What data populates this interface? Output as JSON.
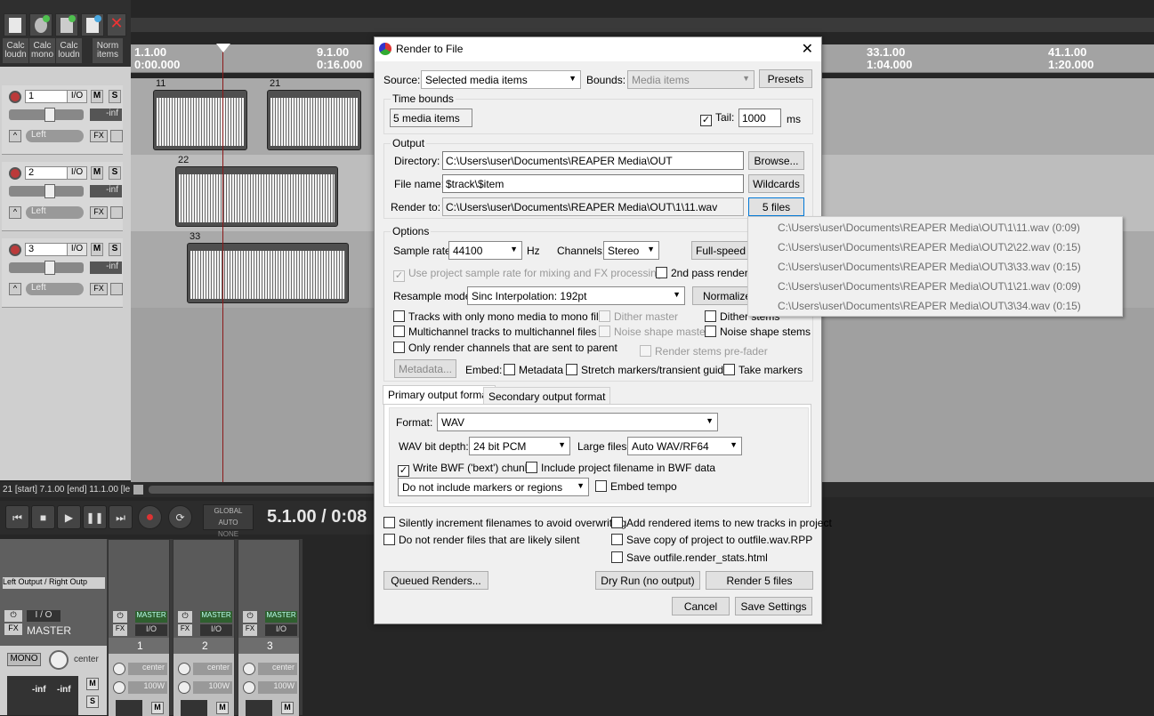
{
  "toolbar": {
    "action_buttons": [
      "Calc loudn",
      "Calc mono",
      "Calc loudn",
      "Norm items"
    ]
  },
  "ruler": {
    "marks": [
      {
        "bar": "1.1.00",
        "time": "0:00.000"
      },
      {
        "bar": "9.1.00",
        "time": "0:16.000"
      },
      {
        "bar": "33.1.00",
        "time": "1:04.000"
      },
      {
        "bar": "41.1.00",
        "time": "1:20.000"
      }
    ]
  },
  "tracks": [
    {
      "num": "1",
      "io": "I/O",
      "m": "M",
      "s": "S",
      "vol": "-inf",
      "pan": "Left",
      "fx": "FX"
    },
    {
      "num": "2",
      "io": "I/O",
      "m": "M",
      "s": "S",
      "vol": "-inf",
      "pan": "Left",
      "fx": "FX"
    },
    {
      "num": "3",
      "io": "I/O",
      "m": "M",
      "s": "S",
      "vol": "-inf",
      "pan": "Left",
      "fx": "FX"
    }
  ],
  "items": [
    "11",
    "21",
    "22",
    "33"
  ],
  "status_bar": "21 [start] 7.1.00 [end] 11.1.00 [le",
  "transport": {
    "global_auto": "GLOBAL AUTO",
    "none": "NONE",
    "position": "5.1.00 / 0:08"
  },
  "mixer": {
    "output": "Left Output / Right Outp",
    "master": "MASTER",
    "io": "I / O",
    "fx": "FX",
    "mono": "MONO",
    "center": "center",
    "inf_l": "-inf",
    "inf_r": "-inf",
    "channels": [
      {
        "num": "1",
        "badge": "MASTER",
        "pan": "center",
        "width": "100W"
      },
      {
        "num": "2",
        "badge": "MASTER",
        "pan": "center",
        "width": "100W"
      },
      {
        "num": "3",
        "badge": "MASTER",
        "pan": "center",
        "width": "100W"
      }
    ]
  },
  "dialog": {
    "title": "Render to File",
    "close": "✕",
    "source_label": "Source:",
    "source_value": "Selected media items",
    "bounds_label": "Bounds:",
    "bounds_value": "Media items",
    "presets": "Presets",
    "time_bounds_title": "Time bounds",
    "time_bounds_value": "5 media items",
    "tail_label": "Tail:",
    "tail_value": "1000",
    "tail_unit": "ms",
    "output_title": "Output",
    "directory_label": "Directory:",
    "directory_value": "C:\\Users\\user\\Documents\\REAPER Media\\OUT",
    "browse": "Browse...",
    "filename_label": "File name:",
    "filename_value": "$track\\$item",
    "wildcards": "Wildcards",
    "renderto_label": "Render to:",
    "renderto_value": "C:\\Users\\user\\Documents\\REAPER Media\\OUT\\1\\11.wav",
    "files_button": "5 files",
    "options_title": "Options",
    "samplerate_label": "Sample rate:",
    "samplerate_value": "44100",
    "hz": "Hz",
    "channels_label": "Channels:",
    "channels_value": "Stereo",
    "fullspeed": "Full-speed O",
    "use_project_rate": "Use project sample rate for mixing and FX processing",
    "second_pass": "2nd pass render",
    "resample_label": "Resample mode:",
    "resample_value": "Sinc Interpolation: 192pt",
    "normalize": "Normalize/",
    "mono_tracks": "Tracks with only mono media to mono file",
    "dither_master": "Dither master",
    "dither_stems": "Dither stems",
    "multichannel": "Multichannel tracks to multichannel files",
    "noise_master": "Noise shape master",
    "noise_stems": "Noise shape stems",
    "only_parent": "Only render channels that are sent to parent",
    "stems_prefader": "Render stems pre-fader",
    "metadata_button": "Metadata...",
    "embed_label": "Embed:",
    "embed_metadata": "Metadata",
    "embed_stretch": "Stretch markers/transient guides",
    "embed_take": "Take markers",
    "tab_primary": "Primary output format",
    "tab_secondary": "Secondary output format",
    "format_label": "Format:",
    "format_value": "WAV",
    "bitdepth_label": "WAV bit depth:",
    "bitdepth_value": "24 bit PCM",
    "largefiles_label": "Large files:",
    "largefiles_value": "Auto WAV/RF64",
    "write_bwf": "Write BWF ('bext') chunk",
    "include_filename": "Include project filename in BWF data",
    "markers_value": "Do not include markers or regions",
    "embed_tempo": "Embed tempo",
    "silently_increment": "Silently increment filenames to avoid overwriting",
    "add_rendered": "Add rendered items to new tracks in project",
    "skip_silent": "Do not render files that are likely silent",
    "save_copy": "Save copy of project to outfile.wav.RPP",
    "save_stats": "Save outfile.render_stats.html",
    "queued": "Queued Renders...",
    "dry_run": "Dry Run (no output)",
    "render": "Render 5 files",
    "cancel": "Cancel",
    "save_settings": "Save Settings"
  },
  "files_popup": [
    "C:\\Users\\user\\Documents\\REAPER Media\\OUT\\1\\11.wav  (0:09)",
    "C:\\Users\\user\\Documents\\REAPER Media\\OUT\\2\\22.wav  (0:15)",
    "C:\\Users\\user\\Documents\\REAPER Media\\OUT\\3\\33.wav  (0:15)",
    "C:\\Users\\user\\Documents\\REAPER Media\\OUT\\1\\21.wav  (0:09)",
    "C:\\Users\\user\\Documents\\REAPER Media\\OUT\\3\\34.wav  (0:15)"
  ]
}
